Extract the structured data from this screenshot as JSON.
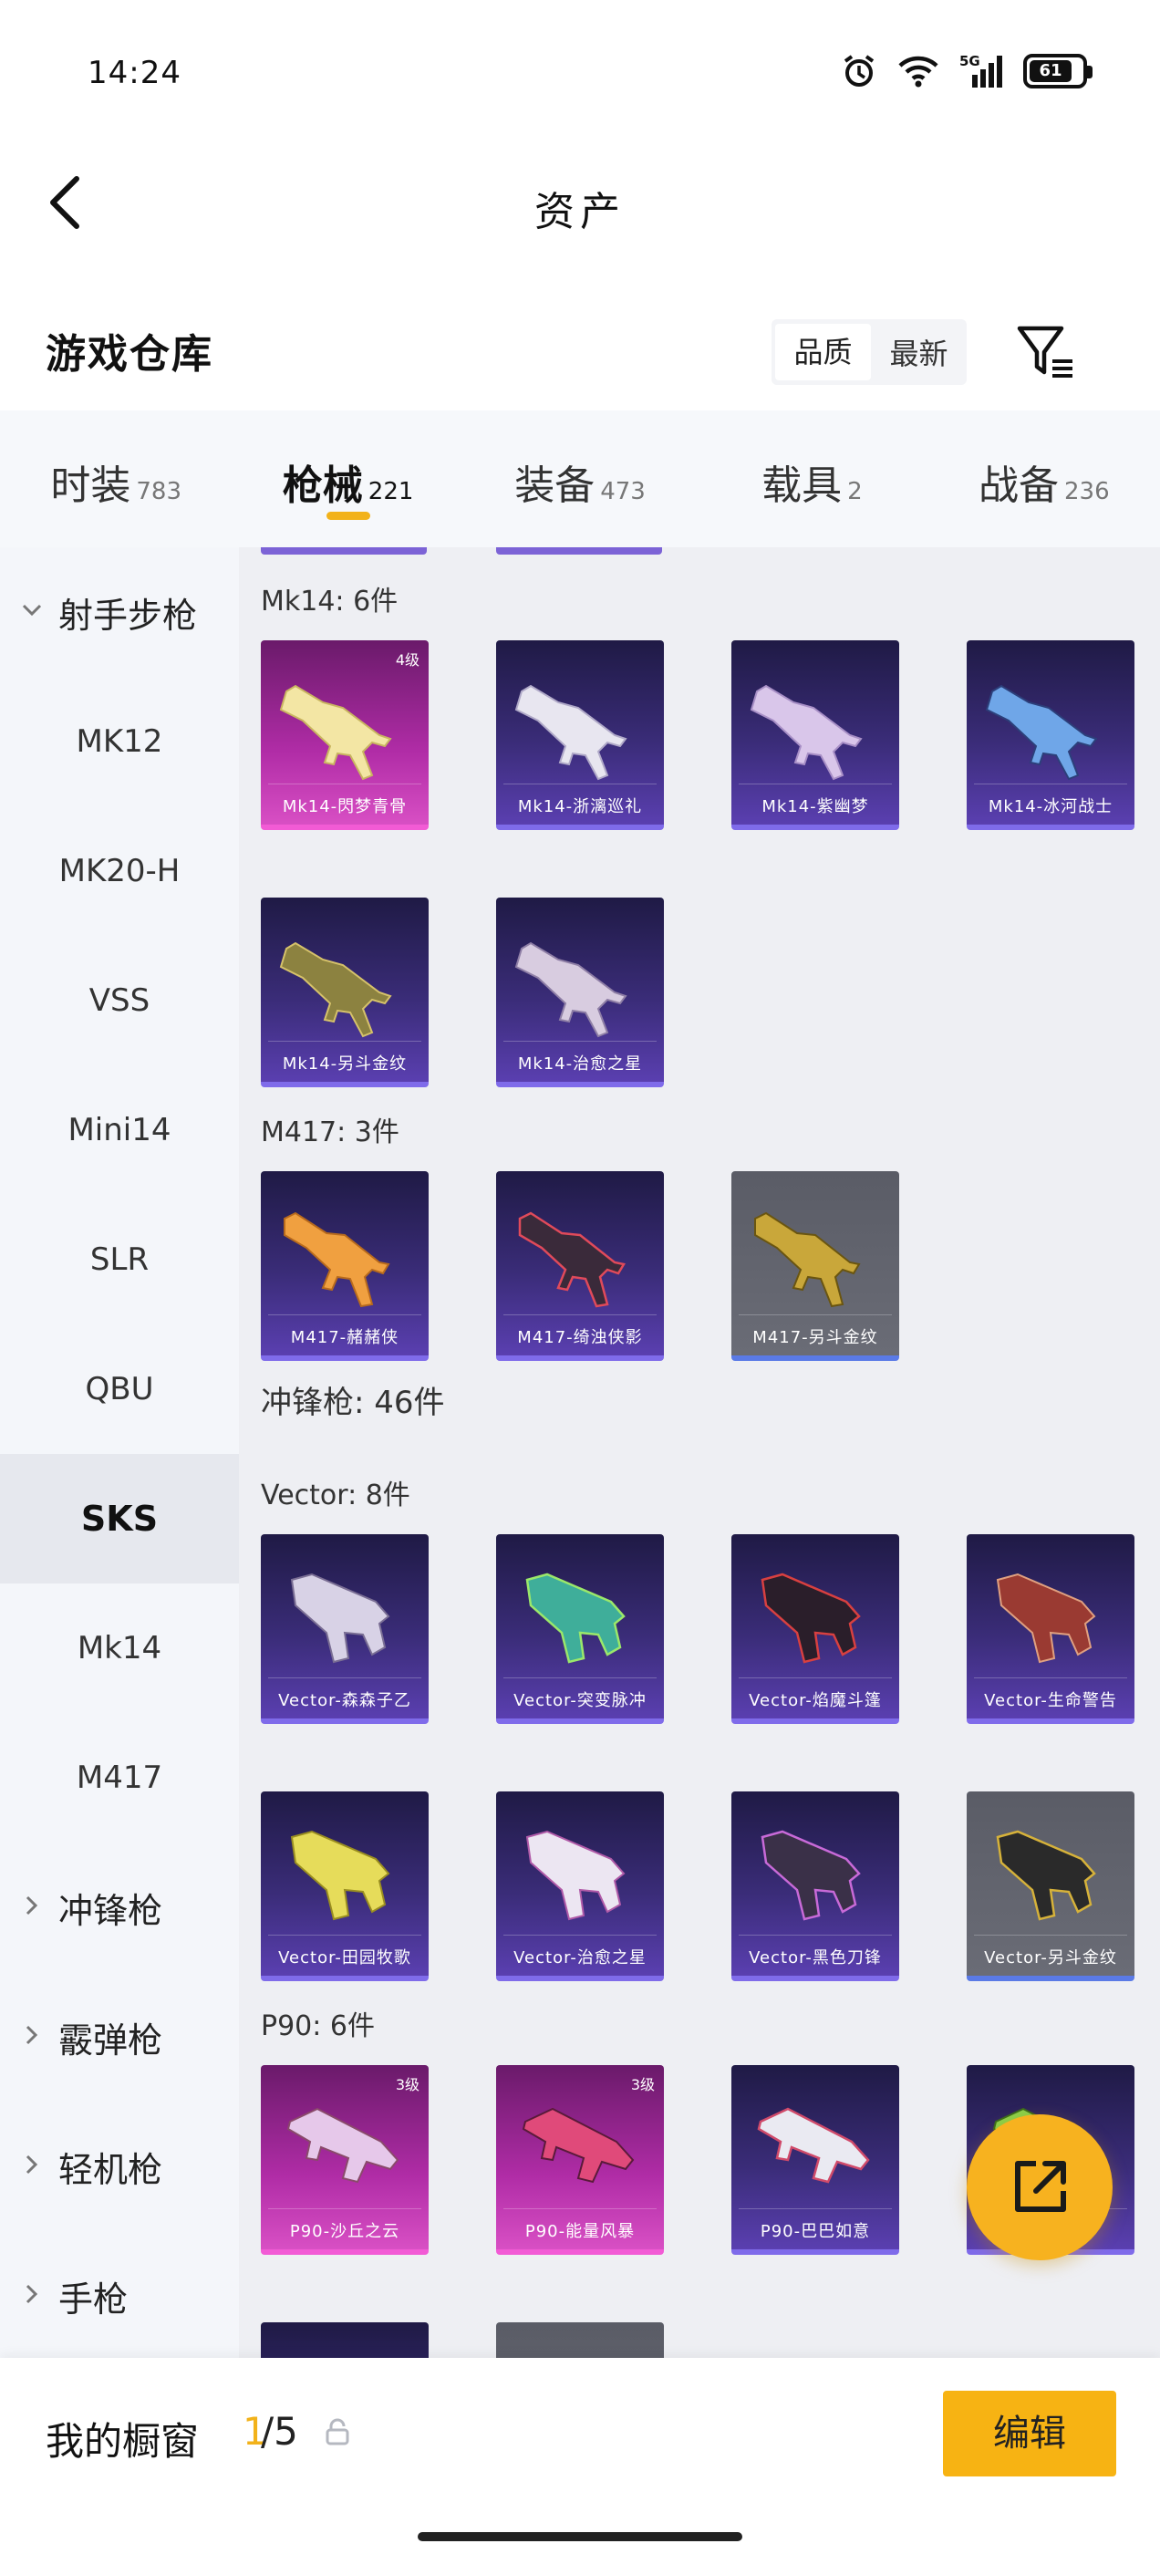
{
  "status_bar": {
    "time": "14:24",
    "network": "5G",
    "battery": "61"
  },
  "header": {
    "title": "资产"
  },
  "warehouse": {
    "title": "游戏仓库",
    "sort_options": [
      "品质",
      "最新"
    ]
  },
  "tabs": [
    {
      "label": "时装",
      "count": "783"
    },
    {
      "label": "枪械",
      "count": "221"
    },
    {
      "label": "装备",
      "count": "473"
    },
    {
      "label": "载具",
      "count": "2"
    },
    {
      "label": "战备",
      "count": "236"
    }
  ],
  "sidebar": {
    "group_open": "射手步枪",
    "items": [
      "MK12",
      "MK20-H",
      "VSS",
      "Mini14",
      "SLR",
      "QBU",
      "SKS",
      "Mk14",
      "M417"
    ],
    "groups": [
      "冲锋枪",
      "霰弹枪",
      "轻机枪",
      "手枪"
    ]
  },
  "sections": {
    "mk14": "Mk14: 6件",
    "m417": "M417: 3件",
    "smg": "冲锋枪: 46件",
    "vector": "Vector: 8件",
    "p90": "P90: 6件"
  },
  "cards": {
    "mk14": [
      {
        "name": "Mk14-閃梦青骨",
        "level": "4级"
      },
      {
        "name": "Mk14-浙漓巡礼",
        "level": ""
      },
      {
        "name": "Mk14-紫幽梦",
        "level": ""
      },
      {
        "name": "Mk14-冰河战士",
        "level": ""
      },
      {
        "name": "Mk14-另斗金纹",
        "level": ""
      },
      {
        "name": "Mk14-治愈之星",
        "level": ""
      }
    ],
    "m417": [
      {
        "name": "M417-赭赭侠",
        "level": ""
      },
      {
        "name": "M417-绮浊侠影",
        "level": ""
      },
      {
        "name": "M417-另斗金纹",
        "level": ""
      }
    ],
    "vector": [
      {
        "name": "Vector-森森子乙",
        "level": ""
      },
      {
        "name": "Vector-突变脉冲",
        "level": ""
      },
      {
        "name": "Vector-焰魔斗篷",
        "level": ""
      },
      {
        "name": "Vector-生命警告",
        "level": ""
      },
      {
        "name": "Vector-田园牧歌",
        "level": ""
      },
      {
        "name": "Vector-治愈之星",
        "level": ""
      },
      {
        "name": "Vector-黑色刀锋",
        "level": ""
      },
      {
        "name": "Vector-另斗金纹",
        "level": ""
      }
    ],
    "p90": [
      {
        "name": "P90-沙丘之云",
        "level": "3级"
      },
      {
        "name": "P90-能量风暴",
        "level": "3级"
      },
      {
        "name": "P90-巴巴如意",
        "level": ""
      }
    ]
  },
  "showcase": {
    "label": "我的橱窗",
    "current": "1",
    "total": "/5",
    "edit_label": "编辑"
  }
}
